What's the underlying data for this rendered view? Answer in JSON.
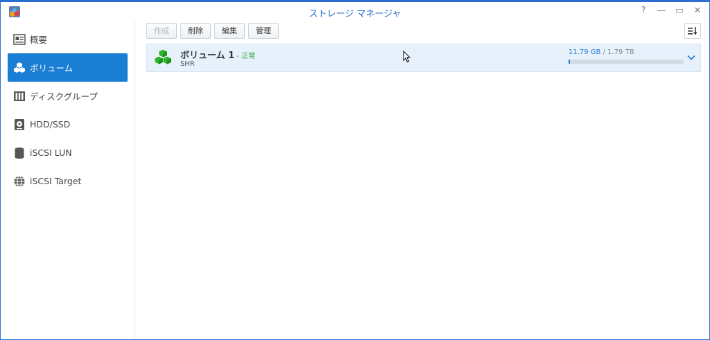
{
  "window": {
    "title": "ストレージ マネージャ",
    "controls": {
      "help": "?",
      "minimize": "—",
      "maximize": "▭",
      "close": "✕"
    }
  },
  "sidebar": {
    "items": [
      {
        "label": "概要",
        "icon": "overview-icon"
      },
      {
        "label": "ボリューム",
        "icon": "volume-icon"
      },
      {
        "label": "ディスクグループ",
        "icon": "disk-group-icon"
      },
      {
        "label": "HDD/SSD",
        "icon": "hdd-icon"
      },
      {
        "label": "iSCSI LUN",
        "icon": "iscsi-lun-icon"
      },
      {
        "label": "iSCSI Target",
        "icon": "iscsi-target-icon"
      }
    ],
    "active_index": 1
  },
  "toolbar": {
    "create_label": "作成",
    "delete_label": "削除",
    "edit_label": "編集",
    "manage_label": "管理"
  },
  "volumes": [
    {
      "name": "ボリューム 1",
      "separator": " - ",
      "status": "正常",
      "type": "SHR",
      "used": "11.79 GB",
      "total": " / 1.79 TB",
      "usage_fraction": 0.0066
    }
  ],
  "colors": {
    "accent": "#1a7fd4",
    "status_ok": "#2aa03a",
    "volume_icon": "#2fb52f"
  }
}
